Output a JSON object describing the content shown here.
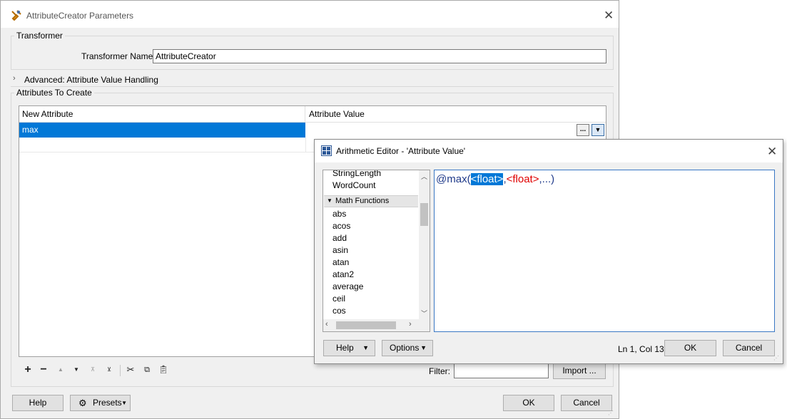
{
  "main_window": {
    "title": "AttributeCreator Parameters",
    "transformer_group": {
      "legend": "Transformer",
      "name_label": "Transformer Name:",
      "name_value": "AttributeCreator"
    },
    "advanced_label": "Advanced: Attribute Value Handling",
    "attributes_group": {
      "legend": "Attributes To Create",
      "columns": [
        "New Attribute",
        "Attribute Value"
      ],
      "rows": [
        {
          "attribute": "max",
          "value": "",
          "ellipsis": "..."
        }
      ]
    },
    "filter_label": "Filter:",
    "filter_value": "",
    "import_button": "Import ...",
    "help_button": "Help",
    "presets_button": "Presets",
    "ok_button": "OK",
    "cancel_button": "Cancel"
  },
  "editor": {
    "title": "Arithmetic Editor - 'Attribute Value'",
    "function_list": {
      "items_before": [
        "StringLength",
        "WordCount"
      ],
      "category": "Math Functions",
      "items": [
        "abs",
        "acos",
        "add",
        "asin",
        "atan",
        "atan2",
        "average",
        "ceil",
        "cos"
      ]
    },
    "expression": {
      "prefix": "@max(",
      "selected": "<float>",
      "comma": ",",
      "param2": "<float>",
      "suffix": ",...)"
    },
    "help_button": "Help",
    "options_button": "Options",
    "cursor_status": "Ln 1, Col 13",
    "ok_button": "OK",
    "cancel_button": "Cancel"
  },
  "colors": {
    "selection": "#0078d7",
    "expression_function": "#1f3a8a",
    "expression_param": "#e00000"
  }
}
